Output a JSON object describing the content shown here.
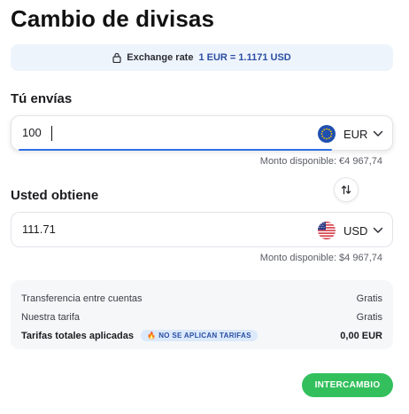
{
  "page": {
    "title": "Cambio de divisas"
  },
  "rate": {
    "label": "Exchange rate",
    "value": "1 EUR = 1.1171 USD"
  },
  "send": {
    "label": "Tú envías",
    "amount": "100",
    "currency": "EUR",
    "flag_icon": "eu-flag-icon",
    "available": "Monto disponible: €4 967,74"
  },
  "get": {
    "label": "Usted obtiene",
    "amount": "111.71",
    "currency": "USD",
    "flag_icon": "us-flag-icon",
    "available": "Monto disponible: $4 967,74"
  },
  "fees": {
    "rows": [
      {
        "label": "Transferencia entre cuentas",
        "value": "Gratis"
      },
      {
        "label": "Nuestra tarifa",
        "value": "Gratis"
      }
    ],
    "total": {
      "label": "Tarifas totales aplicadas",
      "badge": "NO SE APLICAN TARIFAS",
      "value": "0,00 EUR"
    }
  },
  "actions": {
    "exchange": "INTERCAMBIO"
  },
  "colors": {
    "accent_blue": "#2f6fe8",
    "button_green": "#33c05c",
    "rate_text": "#2a4ea3",
    "banner_bg": "#eef4fc"
  }
}
